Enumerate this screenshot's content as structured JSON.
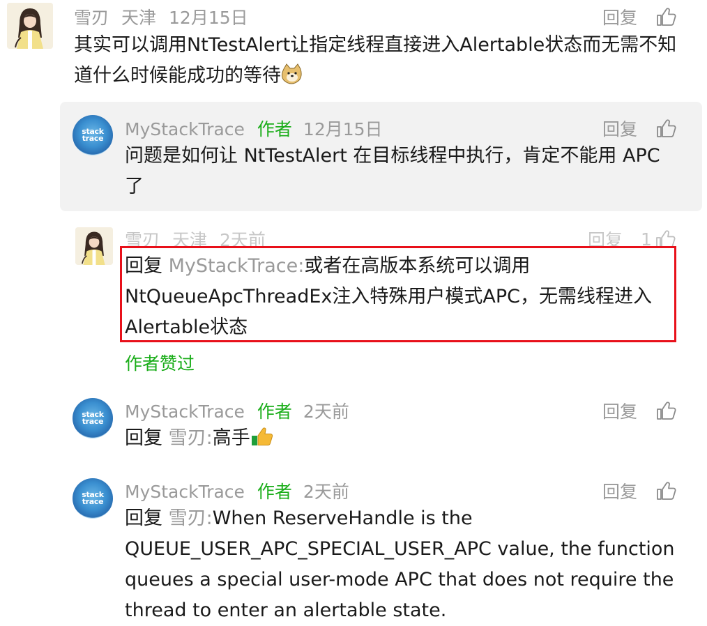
{
  "comments": [
    {
      "name": "雪刃",
      "location": "天津",
      "date": "12月15日",
      "reply_label": "回复",
      "text": "其实可以调用NtTestAlert让指定线程直接进入Alertable状态而无需不知道什么时候能成功的等待"
    },
    {
      "name": "MyStackTrace",
      "author_tag": "作者",
      "date": "12月15日",
      "reply_label": "回复",
      "text": "问题是如何让 NtTestAlert 在目标线程中执行，肯定不能用 APC 了"
    },
    {
      "name": "雪刃",
      "location": "天津",
      "date": "2天前",
      "reply_label": "回复",
      "like_count": "1",
      "reply_prefix": "回复",
      "reply_to": "MyStackTrace",
      "text": "或者在高版本系统可以调用NtQueueApcThreadEx注入特殊用户模式APC，无需线程进入Alertable状态",
      "author_liked": "作者赞过"
    },
    {
      "name": "MyStackTrace",
      "author_tag": "作者",
      "date": "2天前",
      "reply_label": "回复",
      "reply_prefix": "回复",
      "reply_to": "雪刃",
      "text": "高手"
    },
    {
      "name": "MyStackTrace",
      "author_tag": "作者",
      "date": "2天前",
      "reply_label": "回复",
      "reply_prefix": "回复",
      "reply_to": "雪刃",
      "text": "When ReserveHandle is the QUEUE_USER_APC_SPECIAL_USER_APC value, the function queues a special user-mode APC that does not require the thread to enter an alertable state."
    }
  ],
  "avatar_logo": {
    "line1": "stack",
    "line2": "trace"
  },
  "colors": {
    "accent_green": "#1aad19",
    "highlight_red": "#e8101a",
    "meta_gray": "#9a9a9a",
    "author_bg": "#f2f2f2"
  }
}
